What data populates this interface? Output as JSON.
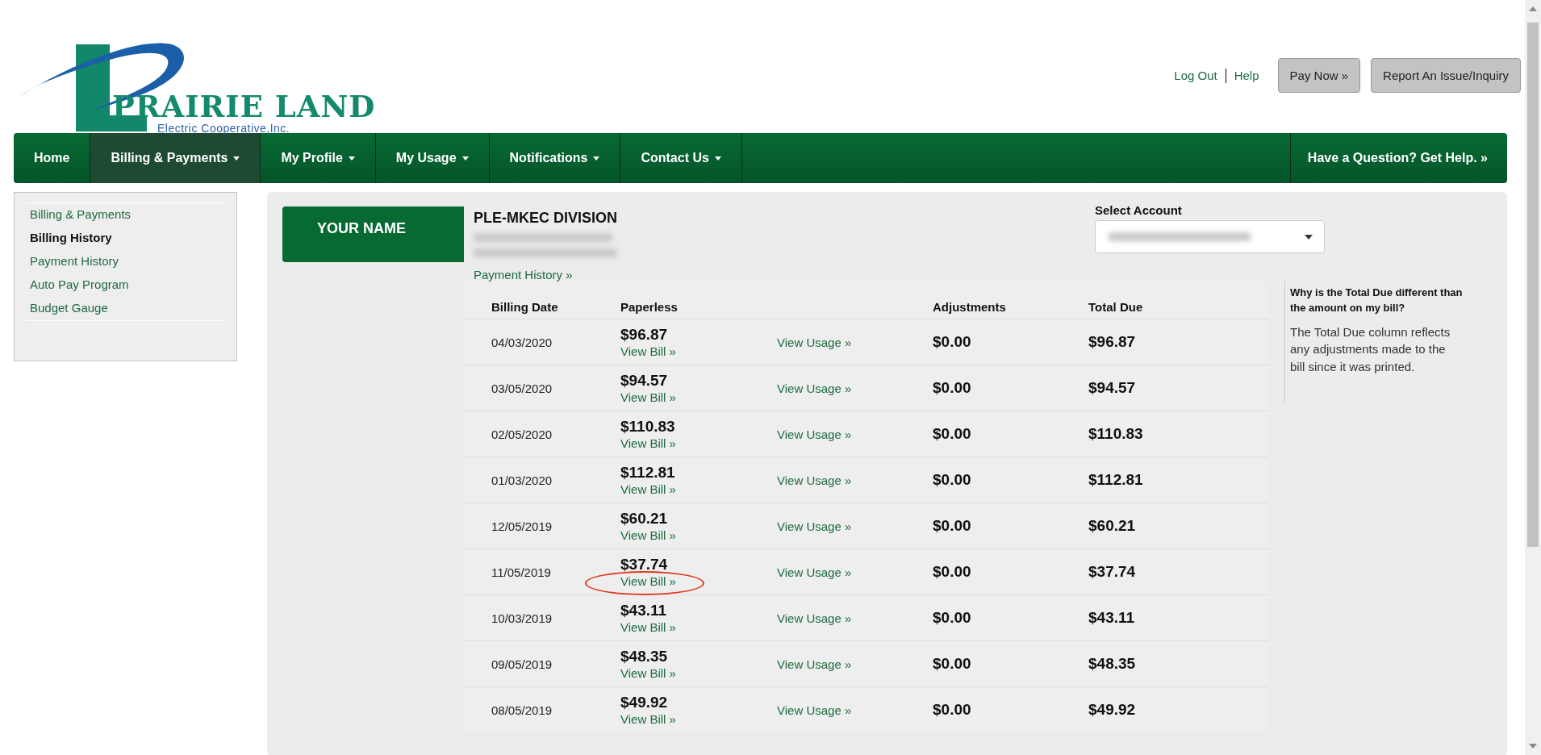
{
  "logo": {
    "name": "PRAIRIE LAND",
    "tagline": "Electric Cooperative,Inc."
  },
  "header_links": [
    "Log Out",
    "Help"
  ],
  "header_buttons": [
    "Pay Now »",
    "Report An Issue/Inquiry"
  ],
  "nav": {
    "items": [
      {
        "label": "Home",
        "dropdown": false,
        "selected": false
      },
      {
        "label": "Billing & Payments",
        "dropdown": true,
        "selected": true
      },
      {
        "label": "My Profile",
        "dropdown": true,
        "selected": false
      },
      {
        "label": "My Usage",
        "dropdown": true,
        "selected": false
      },
      {
        "label": "Notifications",
        "dropdown": true,
        "selected": false
      },
      {
        "label": "Contact Us",
        "dropdown": true,
        "selected": false
      }
    ],
    "help": "Have a Question? Get Help. »"
  },
  "sidebar": {
    "items": [
      {
        "label": "Billing & Payments",
        "selected": false
      },
      {
        "label": "Billing History",
        "selected": true
      },
      {
        "label": "Payment History",
        "selected": false
      },
      {
        "label": "Auto Pay Program",
        "selected": false
      },
      {
        "label": "Budget Gauge",
        "selected": false
      }
    ]
  },
  "account": {
    "name": "YOUR NAME",
    "division": "PLE-MKEC DIVISION",
    "payment_history_link": "Payment History »",
    "select_label": "Select Account"
  },
  "table": {
    "columns": [
      "Billing Date",
      "Paperless",
      "Adjustments",
      "Total Due"
    ],
    "rows": [
      {
        "date": "04/03/2020",
        "amount": "$96.87",
        "view_bill": "View Bill »",
        "view_usage": "View Usage »",
        "adjustments": "$0.00",
        "total": "$96.87",
        "circled": false
      },
      {
        "date": "03/05/2020",
        "amount": "$94.57",
        "view_bill": "View Bill »",
        "view_usage": "View Usage »",
        "adjustments": "$0.00",
        "total": "$94.57",
        "circled": false
      },
      {
        "date": "02/05/2020",
        "amount": "$110.83",
        "view_bill": "View Bill »",
        "view_usage": "View Usage »",
        "adjustments": "$0.00",
        "total": "$110.83",
        "circled": false
      },
      {
        "date": "01/03/2020",
        "amount": "$112.81",
        "view_bill": "View Bill »",
        "view_usage": "View Usage »",
        "adjustments": "$0.00",
        "total": "$112.81",
        "circled": false
      },
      {
        "date": "12/05/2019",
        "amount": "$60.21",
        "view_bill": "View Bill »",
        "view_usage": "View Usage »",
        "adjustments": "$0.00",
        "total": "$60.21",
        "circled": false
      },
      {
        "date": "11/05/2019",
        "amount": "$37.74",
        "view_bill": "View Bill »",
        "view_usage": "View Usage »",
        "adjustments": "$0.00",
        "total": "$37.74",
        "circled": true
      },
      {
        "date": "10/03/2019",
        "amount": "$43.11",
        "view_bill": "View Bill »",
        "view_usage": "View Usage »",
        "adjustments": "$0.00",
        "total": "$43.11",
        "circled": false
      },
      {
        "date": "09/05/2019",
        "amount": "$48.35",
        "view_bill": "View Bill »",
        "view_usage": "View Usage »",
        "adjustments": "$0.00",
        "total": "$48.35",
        "circled": false
      },
      {
        "date": "08/05/2019",
        "amount": "$49.92",
        "view_bill": "View Bill »",
        "view_usage": "View Usage »",
        "adjustments": "$0.00",
        "total": "$49.92",
        "circled": false
      }
    ]
  },
  "note": {
    "title": "Why is the Total Due different than the amount on my bill?",
    "body": "The Total Due column reflects any adjustments made to the bill since it was printed."
  }
}
